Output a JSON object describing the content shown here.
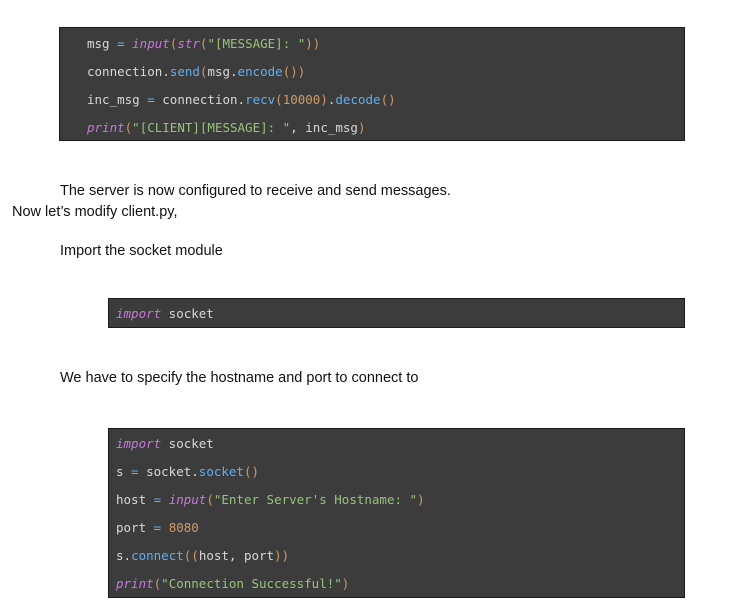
{
  "block1": {
    "lines": [
      [
        [
          "msg",
          "id"
        ],
        [
          " = ",
          "op"
        ],
        [
          "input",
          "kw"
        ],
        [
          "(",
          "par"
        ],
        [
          "str",
          "kw"
        ],
        [
          "(",
          "par"
        ],
        [
          "\"[MESSAGE]: \"",
          "str"
        ],
        [
          "))",
          "par"
        ]
      ],
      [
        [
          "connection",
          "id"
        ],
        [
          ".",
          "id"
        ],
        [
          "send",
          "fn"
        ],
        [
          "(",
          "par"
        ],
        [
          "msg",
          "id"
        ],
        [
          ".",
          "id"
        ],
        [
          "encode",
          "fn"
        ],
        [
          "())",
          "par"
        ]
      ],
      [
        [
          "inc_msg",
          "id"
        ],
        [
          " = ",
          "op"
        ],
        [
          "connection",
          "id"
        ],
        [
          ".",
          "id"
        ],
        [
          "recv",
          "fn"
        ],
        [
          "(",
          "par"
        ],
        [
          "10000",
          "num"
        ],
        [
          ")",
          "par"
        ],
        [
          ".",
          "id"
        ],
        [
          "decode",
          "fn"
        ],
        [
          "()",
          "par"
        ]
      ],
      [
        [
          "print",
          "kw"
        ],
        [
          "(",
          "par"
        ],
        [
          "\"[CLIENT][MESSAGE]: \"",
          "str"
        ],
        [
          ", inc_msg",
          "id"
        ],
        [
          ")",
          "par"
        ]
      ]
    ]
  },
  "text": {
    "p1": "The server is now configured to receive and send messages.",
    "p2": "Now let’s modify client.py,",
    "p3": "Import the socket module",
    "p4": "We have to specify the hostname and port to connect to"
  },
  "block2": {
    "lines": [
      [
        [
          "import",
          "kw"
        ],
        [
          " socket",
          "id"
        ]
      ]
    ]
  },
  "block3": {
    "lines": [
      [
        [
          "import",
          "kw"
        ],
        [
          " socket",
          "id"
        ]
      ],
      [
        [
          "s",
          "id"
        ],
        [
          " = ",
          "op"
        ],
        [
          "socket",
          "id"
        ],
        [
          ".",
          "id"
        ],
        [
          "socket",
          "fn"
        ],
        [
          "()",
          "par"
        ]
      ],
      [
        [
          "host",
          "id"
        ],
        [
          " = ",
          "op"
        ],
        [
          "input",
          "kw"
        ],
        [
          "(",
          "par"
        ],
        [
          "\"Enter Server's Hostname: \"",
          "str"
        ],
        [
          ")",
          "par"
        ]
      ],
      [
        [
          "port",
          "id"
        ],
        [
          " = ",
          "op"
        ],
        [
          "8080",
          "num"
        ]
      ],
      [
        [
          "s",
          "id"
        ],
        [
          ".",
          "id"
        ],
        [
          "connect",
          "fn"
        ],
        [
          "((",
          "par"
        ],
        [
          "host, port",
          "id"
        ],
        [
          "))",
          "par"
        ]
      ],
      [
        [
          "print",
          "kw"
        ],
        [
          "(",
          "par"
        ],
        [
          "\"Connection Successful!\"",
          "str"
        ],
        [
          ")",
          "par"
        ]
      ]
    ]
  }
}
